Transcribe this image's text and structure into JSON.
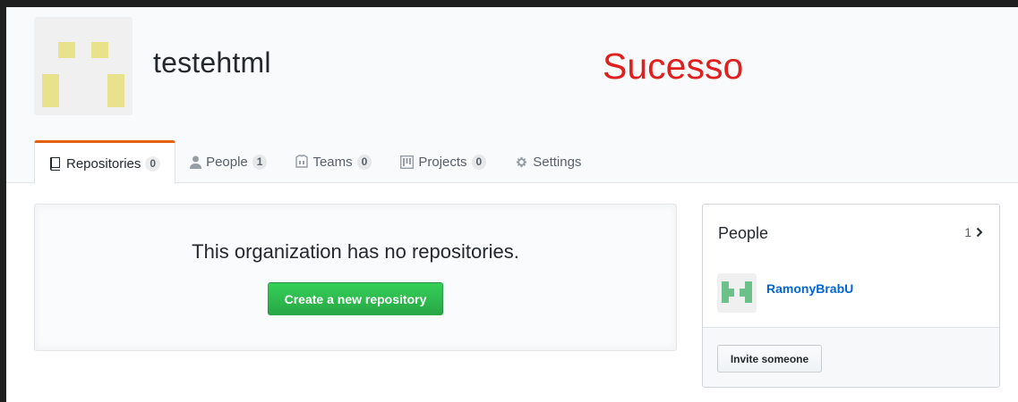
{
  "org": {
    "name": "testehtml",
    "status_text": "Sucesso",
    "avatar_color": "#e8e28c",
    "status_color": "#e0201f"
  },
  "tabs": [
    {
      "label": "Repositories",
      "count": "0",
      "icon": "repo-icon",
      "selected": true
    },
    {
      "label": "People",
      "count": "1",
      "icon": "person-icon",
      "selected": false
    },
    {
      "label": "Teams",
      "count": "0",
      "icon": "jersey-icon",
      "selected": false
    },
    {
      "label": "Projects",
      "count": "0",
      "icon": "project-icon",
      "selected": false
    },
    {
      "label": "Settings",
      "count": "",
      "icon": "gear-icon",
      "selected": false
    }
  ],
  "blank_slate": {
    "title": "This organization has no repositories.",
    "button_label": "Create a new repository"
  },
  "people": {
    "title": "People",
    "count": "1",
    "members": [
      {
        "name": "RamonyBrabU",
        "avatar_color": "#6cc08a"
      }
    ],
    "invite_label": "Invite someone"
  },
  "colors": {
    "accent_tab": "#e36209",
    "primary_button": "#28a745",
    "link": "#0366d6"
  }
}
